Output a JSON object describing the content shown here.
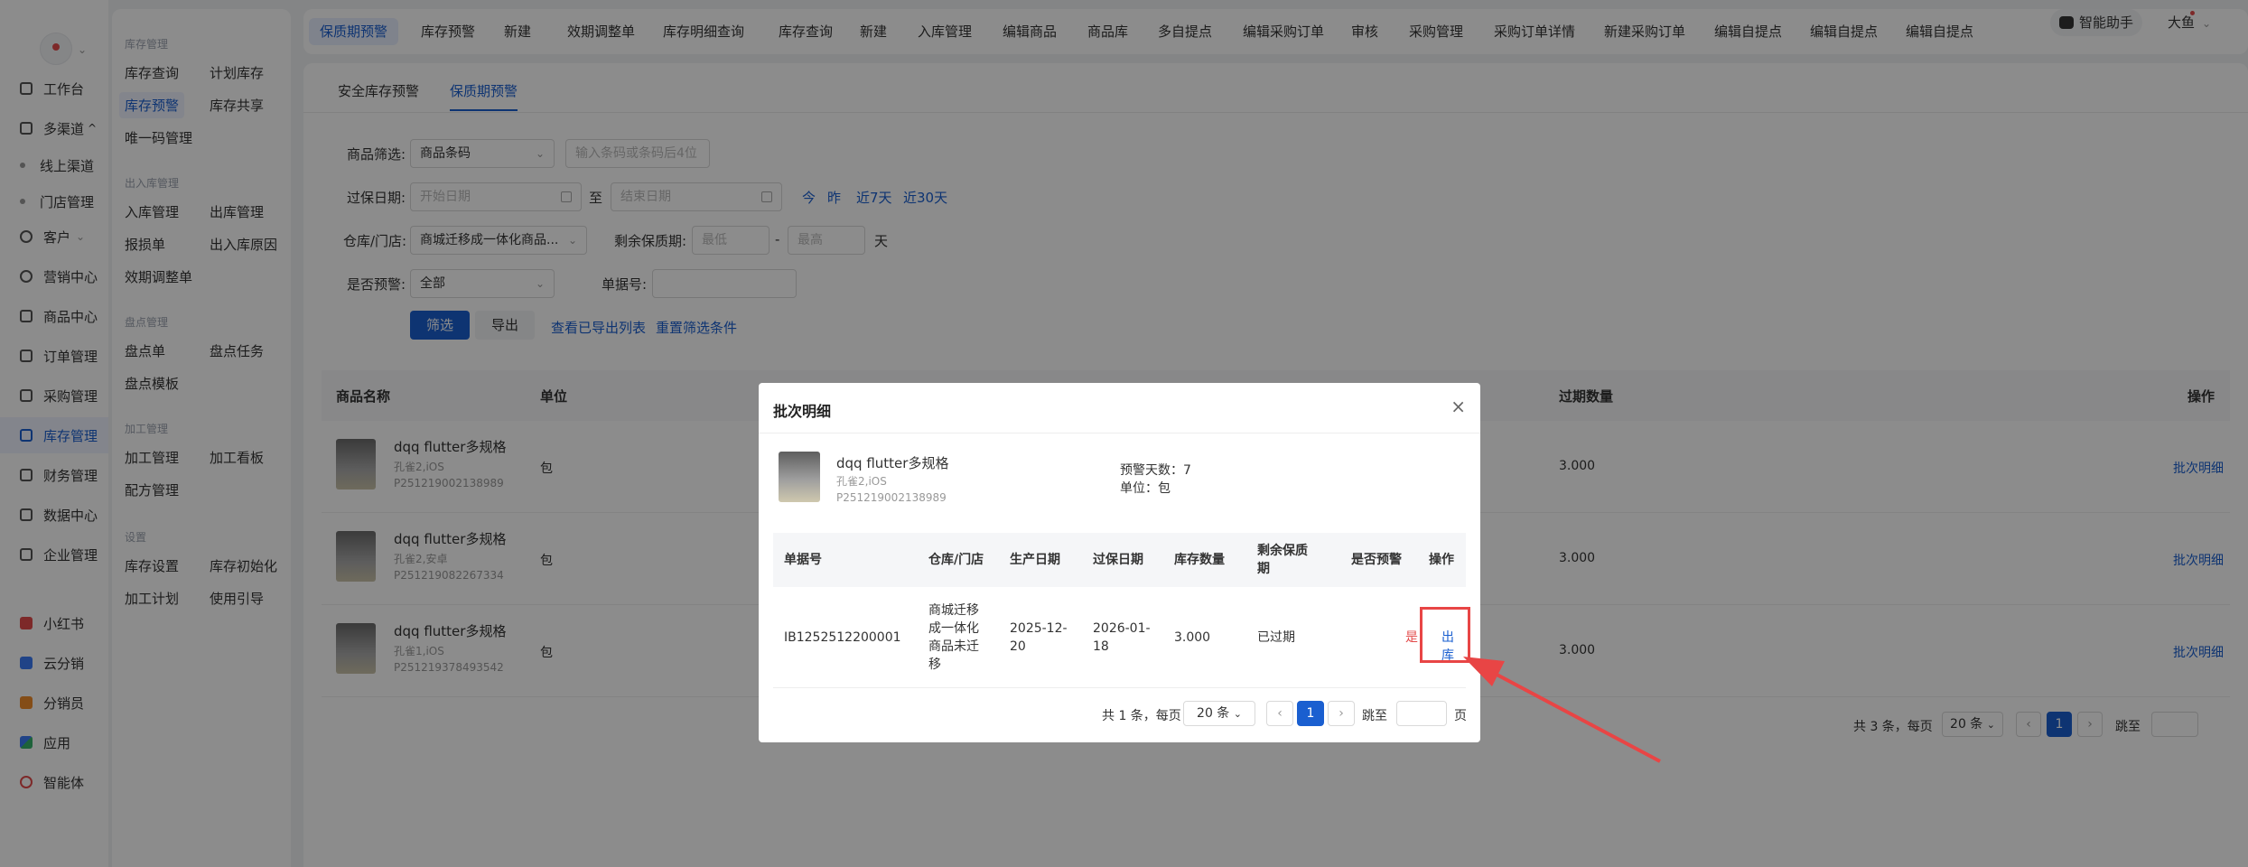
{
  "rail": {
    "items": [
      {
        "label": "工作台",
        "icon": "desk-icon"
      },
      {
        "label": "多渠道",
        "icon": "channel-icon",
        "suffix": "^"
      },
      {
        "label": "线上渠道",
        "sub": true
      },
      {
        "label": "门店管理",
        "sub": true
      },
      {
        "label": "客户",
        "icon": "user-icon",
        "suffix": "v"
      },
      {
        "label": "营销中心",
        "icon": "marketing-icon"
      },
      {
        "label": "商品中心",
        "icon": "goods-icon"
      },
      {
        "label": "订单管理",
        "icon": "order-icon"
      },
      {
        "label": "采购管理",
        "icon": "cart-icon"
      },
      {
        "label": "库存管理",
        "icon": "inventory-icon",
        "active": true
      },
      {
        "label": "财务管理",
        "icon": "finance-icon"
      },
      {
        "label": "数据中心",
        "icon": "chart-icon"
      },
      {
        "label": "企业管理",
        "icon": "company-icon"
      }
    ],
    "apps": [
      {
        "label": "小红书",
        "icon": "xiaohongshu-icon"
      },
      {
        "label": "云分销",
        "icon": "cloud-distribution-icon"
      },
      {
        "label": "分销员",
        "icon": "distributor-icon"
      },
      {
        "label": "应用",
        "icon": "apps-icon"
      },
      {
        "label": "智能体",
        "icon": "agent-icon"
      }
    ]
  },
  "subpanel": {
    "sections": [
      {
        "title": "库存管理",
        "items": [
          "库存查询",
          "计划库存",
          "库存预警",
          "库存共享",
          "唯一码管理"
        ]
      },
      {
        "title": "出入库管理",
        "items": [
          "入库管理",
          "出库管理",
          "报损单",
          "出入库原因",
          "效期调整单"
        ]
      },
      {
        "title": "盘点管理",
        "items": [
          "盘点单",
          "盘点任务",
          "盘点模板"
        ]
      },
      {
        "title": "加工管理",
        "items": [
          "加工管理",
          "加工看板",
          "配方管理"
        ]
      },
      {
        "title": "设置",
        "items": [
          "库存设置",
          "库存初始化",
          "加工计划",
          "使用引导"
        ]
      }
    ],
    "active": "库存预警"
  },
  "tabs": [
    "保质期预警",
    "库存预警",
    "新建",
    "效期调整单",
    "库存明细查询",
    "库存查询",
    "新建",
    "入库管理",
    "编辑商品",
    "商品库",
    "多自提点",
    "编辑采购订单",
    "审核",
    "采购管理",
    "采购订单详情",
    "新建采购订单",
    "编辑自提点",
    "编辑自提点",
    "编辑自提点"
  ],
  "assistant_label": "智能助手",
  "user_label": "大鱼",
  "subtabs": [
    "安全库存预警",
    "保质期预警"
  ],
  "filters": {
    "goods_label": "商品筛选:",
    "goods_select": "商品条码",
    "goods_placeholder": "输入条码或条码后4位",
    "expire_label": "过保日期:",
    "start_placeholder": "开始日期",
    "to": "至",
    "end_placeholder": "结束日期",
    "quick": [
      "今",
      "昨",
      "近7天",
      "近30天"
    ],
    "warehouse_label": "仓库/门店:",
    "warehouse_value": "商城迁移成一体化商品...",
    "remain_label": "剩余保质期:",
    "remain_min_placeholder": "最低",
    "dash": "-",
    "remain_max_placeholder": "最高",
    "day_unit": "天",
    "warn_label": "是否预警:",
    "warn_value": "全部",
    "doc_label": "单据号:",
    "filter_btn": "筛选",
    "export_btn": "导出",
    "view_exports": "查看已导出列表",
    "reset": "重置筛选条件"
  },
  "table": {
    "headers": {
      "name": "商品名称",
      "unit": "单位",
      "qty": "过期数量",
      "action": "操作"
    },
    "rows": [
      {
        "name": "dqq flutter多规格",
        "spec": "孔雀2,iOS",
        "code": "P251219002138989",
        "unit": "包",
        "qty": "3.000",
        "action": "批次明细"
      },
      {
        "name": "dqq flutter多规格",
        "spec": "孔雀2,安卓",
        "code": "P251219082267334",
        "unit": "包",
        "qty": "3.000",
        "action": "批次明细"
      },
      {
        "name": "dqq flutter多规格",
        "spec": "孔雀1,iOS",
        "code": "P251219378493542",
        "unit": "包",
        "qty": "3.000",
        "action": "批次明细"
      }
    ],
    "pagination": {
      "total": "共 3 条，每页",
      "size": "20 条",
      "page": "1",
      "goto": "跳至"
    }
  },
  "modal": {
    "title": "批次明细",
    "close": "×",
    "product": {
      "name": "dqq flutter多规格",
      "spec": "孔雀2,iOS",
      "code": "P251219002138989",
      "warn_days": "预警天数：7",
      "unit": "单位：包"
    },
    "headers": {
      "doc": "单据号",
      "warehouse": "仓库/门店",
      "prod_date": "生产日期",
      "exp_date": "过保日期",
      "stock": "库存数量",
      "remain": "剩余保质期",
      "warn": "是否预警",
      "action": "操作"
    },
    "row": {
      "doc": "IB1252512200001",
      "warehouse": [
        "商城迁移",
        "成一体化",
        "商品未迁",
        "移"
      ],
      "prod_date": [
        "2025-12-",
        "20"
      ],
      "exp_date": [
        "2026-01-",
        "18"
      ],
      "stock": "3.000",
      "remain": "已过期",
      "warn": "是",
      "action": "出库"
    },
    "pagination": {
      "total": "共 1 条，每页",
      "size": "20 条",
      "page": "1",
      "goto": "跳至",
      "page_unit": "页"
    }
  },
  "colors": {
    "accent": "#1a5fd0",
    "danger": "#e34b4b",
    "annotation": "#e84545"
  }
}
